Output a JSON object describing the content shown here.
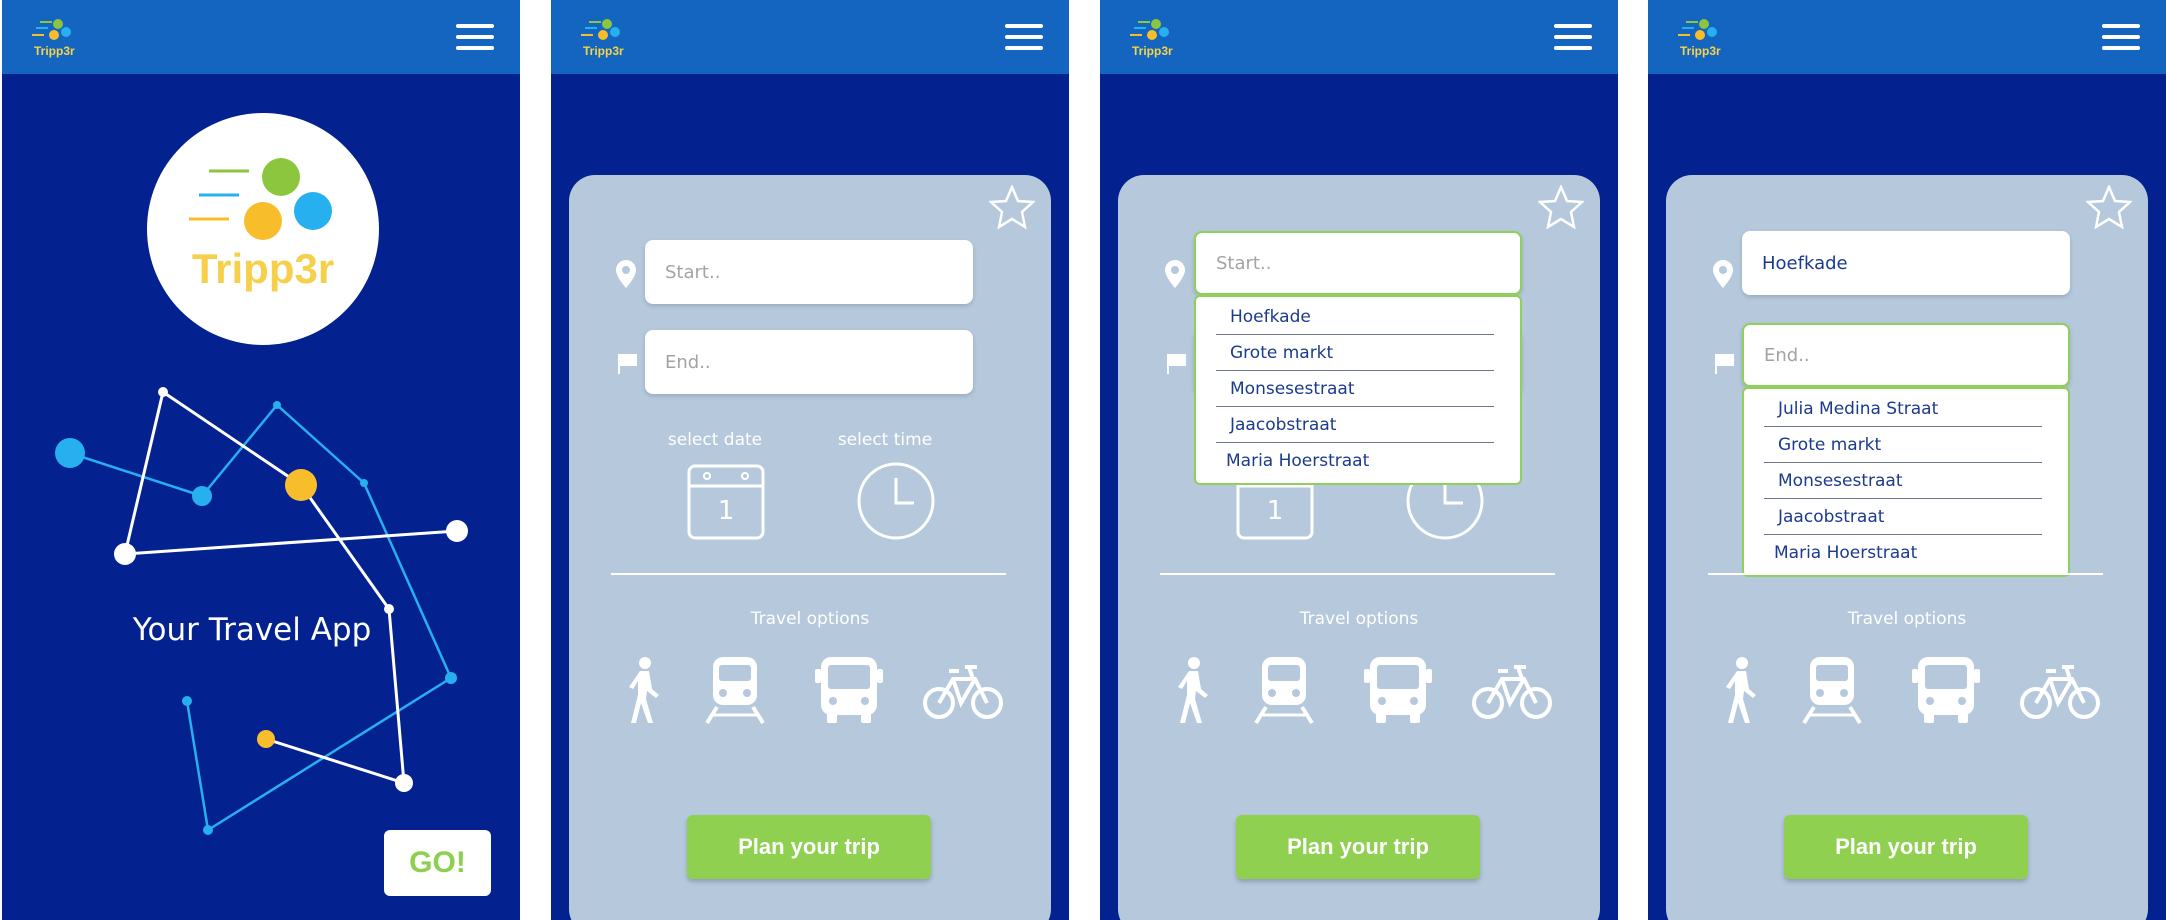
{
  "brand": {
    "name": "Tripp3r"
  },
  "splash": {
    "logo_text": "Tripp3r",
    "tagline": "Your Travel App",
    "go_label": "GO!"
  },
  "planner": {
    "start_placeholder": "Start..",
    "end_placeholder": "End..",
    "start_value": "Hoefkade",
    "date_label": "select date",
    "date_value": "1",
    "time_label": "select time",
    "travel_options_label": "Travel options",
    "plan_button_label": "Plan your trip",
    "travel_modes": [
      "walk-icon",
      "train-icon",
      "bus-icon",
      "bike-icon"
    ]
  },
  "start_suggestions": [
    "Hoefkade",
    "Grote markt",
    "Monsesestraat",
    "Jaacobstraat",
    "Maria Hoerstraat"
  ],
  "end_suggestions": [
    "Julia Medina Straat",
    "Grote markt",
    "Monsesestraat",
    "Jaacobstraat",
    "Maria Hoerstraat"
  ],
  "colors": {
    "header": "#1365bf",
    "background": "#03218f",
    "card": "#b5c8dc",
    "accent_green": "#8fd050",
    "logo_yellow": "#f6d04d",
    "dot_blue": "#27b0f0",
    "dot_yellow": "#f8bd2a",
    "dot_green": "#8cc63f"
  }
}
